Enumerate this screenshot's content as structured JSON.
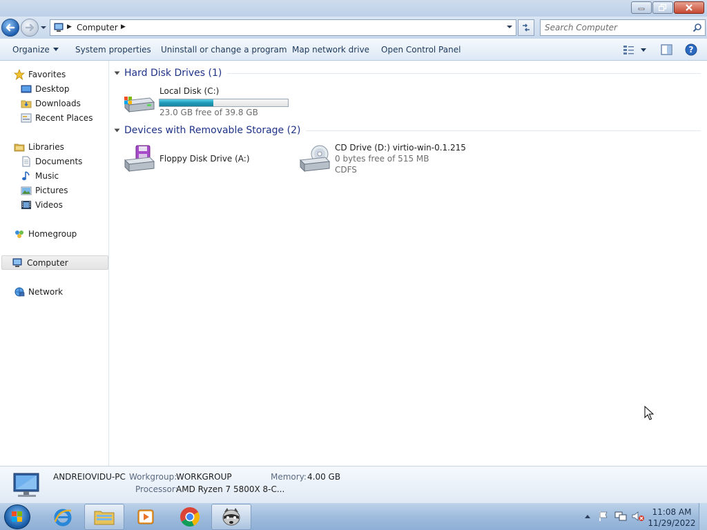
{
  "window": {
    "caption_buttons": [
      "minimize-icon",
      "restore-icon",
      "close-icon"
    ]
  },
  "address": {
    "crumb": "Computer",
    "search_placeholder": "Search Computer"
  },
  "toolbar": {
    "organize": "Organize",
    "system_properties": "System properties",
    "uninstall": "Uninstall or change a program",
    "map_drive": "Map network drive",
    "control_panel": "Open Control Panel"
  },
  "nav": {
    "favorites": "Favorites",
    "desktop": "Desktop",
    "downloads": "Downloads",
    "recent": "Recent Places",
    "libraries": "Libraries",
    "documents": "Documents",
    "music": "Music",
    "pictures": "Pictures",
    "videos": "Videos",
    "homegroup": "Homegroup",
    "computer": "Computer",
    "network": "Network"
  },
  "groups": {
    "hdd_title": "Hard Disk Drives (1)",
    "removable_title": "Devices with Removable Storage (2)"
  },
  "drives": {
    "c": {
      "name": "Local Disk (C:)",
      "free": "23.0 GB free of 39.8 GB",
      "used_fraction": 0.42,
      "bar_color": "#1e9ab8"
    },
    "a": {
      "name": "Floppy Disk Drive (A:)"
    },
    "d": {
      "name": "CD Drive (D:) virtio-win-0.1.215",
      "free": "0 bytes free of 515 MB",
      "fs": "CDFS"
    }
  },
  "details": {
    "pc_name": "ANDREIOVIDU-PC",
    "workgroup_label": "Workgroup:",
    "workgroup": "WORKGROUP",
    "memory_label": "Memory:",
    "memory": "4.00 GB",
    "processor_label": "Processor:",
    "processor": "AMD Ryzen 7 5800X 8-C..."
  },
  "taskbar": {
    "time": "11:08 AM",
    "date": "11/29/2022",
    "apps": [
      "internet-explorer-icon",
      "file-explorer-icon",
      "media-player-icon",
      "chrome-icon",
      "raccoon-app-icon"
    ]
  }
}
